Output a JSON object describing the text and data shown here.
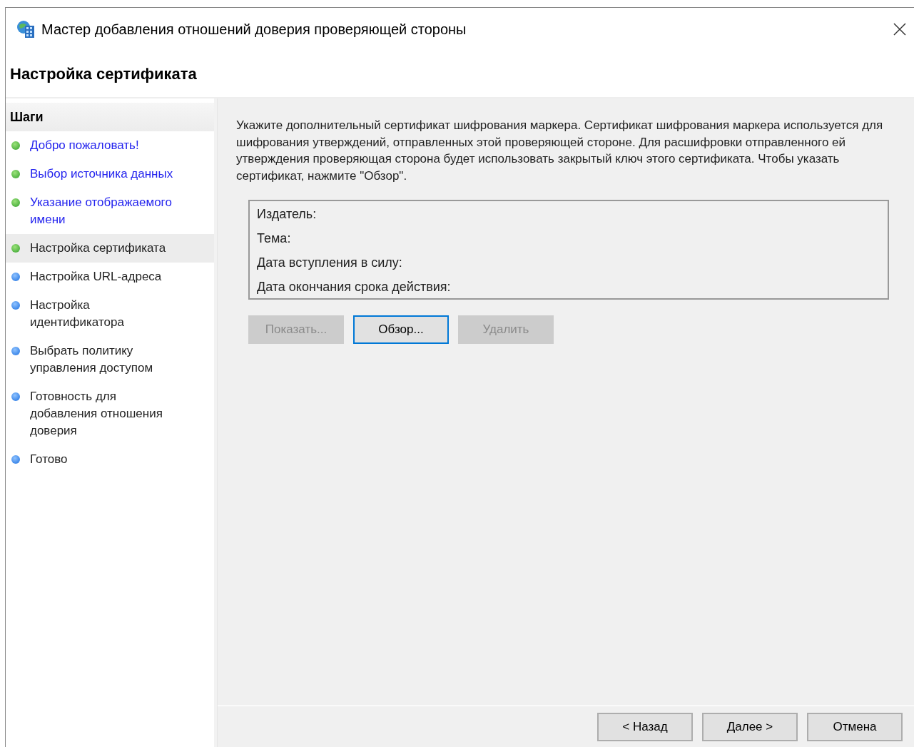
{
  "window": {
    "title": "Мастер добавления отношений доверия проверяющей стороны"
  },
  "page_title": "Настройка сертификата",
  "steps": {
    "heading": "Шаги",
    "items": [
      {
        "label": "Добро пожаловать!",
        "completed": true,
        "selected": false
      },
      {
        "label": "Выбор источника данных",
        "completed": true,
        "selected": false
      },
      {
        "label": "Указание отображаемого имени",
        "completed": true,
        "selected": false
      },
      {
        "label": "Настройка сертификата",
        "completed": true,
        "selected": true
      },
      {
        "label": "Настройка URL-адреса",
        "completed": false,
        "selected": false
      },
      {
        "label": "Настройка идентификатора",
        "completed": false,
        "selected": false
      },
      {
        "label": "Выбрать политику управления доступом",
        "completed": false,
        "selected": false
      },
      {
        "label": "Готовность для добавления отношения доверия",
        "completed": false,
        "selected": false
      },
      {
        "label": "Готово",
        "completed": false,
        "selected": false
      }
    ]
  },
  "description": "Укажите дополнительный сертификат шифрования маркера. Сертификат шифрования маркера используется для шифрования утверждений, отправленных этой проверяющей стороне. Для расшифровки отправленного ей утверждения проверяющая сторона будет использовать закрытый ключ этого сертификата. Чтобы указать сертификат, нажмите \"Обзор\".",
  "certificate_fields": [
    "Издатель:",
    "Тема:",
    "Дата вступления в силу:",
    "Дата окончания срока действия:"
  ],
  "certificate_buttons": [
    {
      "label": "Показать...",
      "disabled": true,
      "focused": false
    },
    {
      "label": "Обзор...",
      "disabled": false,
      "focused": true
    },
    {
      "label": "Удалить",
      "disabled": true,
      "focused": false
    }
  ],
  "footer_buttons": [
    {
      "label": "< Назад",
      "disabled": false,
      "focused": false
    },
    {
      "label": "Далее >",
      "disabled": false,
      "focused": false
    },
    {
      "label": "Отмена",
      "disabled": false,
      "focused": false
    }
  ]
}
